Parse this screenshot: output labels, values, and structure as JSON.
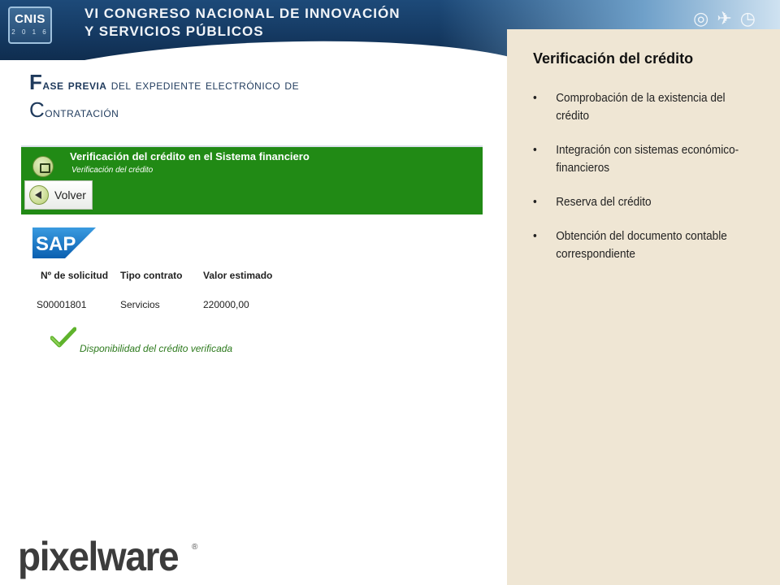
{
  "banner": {
    "logo_text": "CNIS",
    "logo_year": "2 0 1 6",
    "title_line1": "VI CONGRESO NACIONAL DE INNOVACIÓN",
    "title_line2": "Y SERVICIOS PÚBLICOS"
  },
  "heading": {
    "part1_first": "F",
    "part1_rest": "ase previa",
    "part2": " del expediente electrónico de",
    "part3_first": "C",
    "part3_rest": "ontratación"
  },
  "sap_screen": {
    "title": "Verificación del crédito en el Sistema financiero",
    "subtitle": "Verificación del crédito",
    "back_button": "Volver",
    "logo_text": "SAP",
    "table": {
      "headers": [
        "Nº de solicitud",
        "Tipo contrato",
        "Valor estimado"
      ],
      "rows": [
        [
          "S00001801",
          "Servicios",
          "220000,00"
        ]
      ]
    },
    "status_message": "Disponibilidad del crédito verificada"
  },
  "side_panel": {
    "title": "Verificación del crédito",
    "items": [
      "Comprobación de la existencia del crédito",
      "Integración con sistemas económico-financieros",
      "Reserva del crédito",
      "Obtención del documento contable correspondiente"
    ]
  },
  "footer": {
    "logo": "pixelware",
    "reg_mark": "®"
  },
  "colors": {
    "banner_blue": "#153a63",
    "sap_green": "#218a15",
    "side_panel_beige": "#efe6d4",
    "heading_blue": "#1f3a5c",
    "sap_blue": "#0a6ed1"
  }
}
